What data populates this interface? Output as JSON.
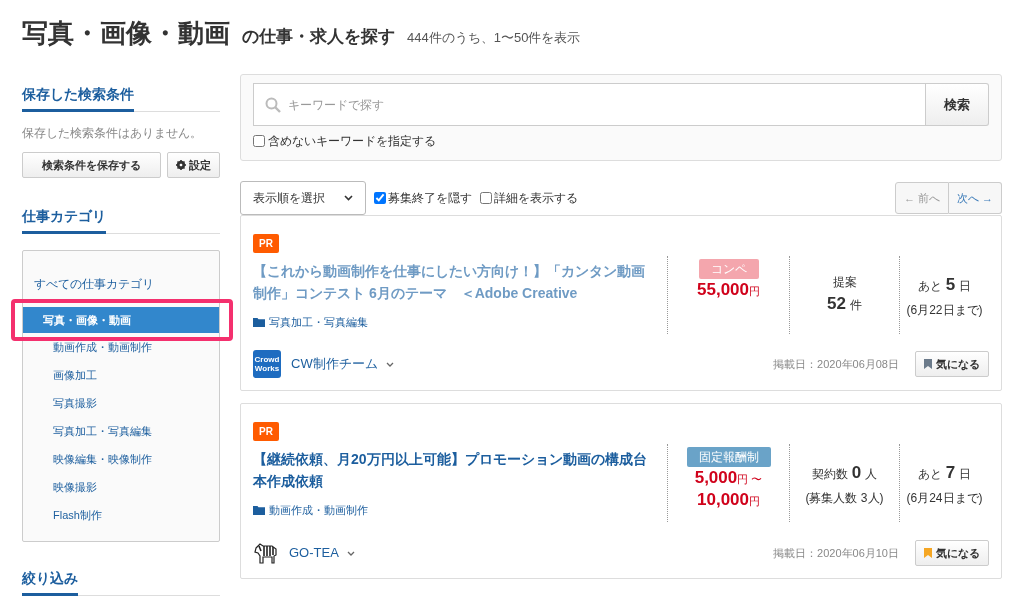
{
  "header": {
    "title": "写真・画像・動画",
    "subtitle": "の仕事・求人を探す",
    "count": "444件のうち、1〜50件を表示"
  },
  "sidebar": {
    "saved": {
      "heading": "保存した検索条件",
      "empty": "保存した検索条件はありません。",
      "save_button": "検索条件を保存する",
      "settings_button": "設定"
    },
    "categories": {
      "heading": "仕事カテゴリ",
      "all": "すべての仕事カテゴリ",
      "items": [
        {
          "label": "写真・画像・動画",
          "selected": true,
          "highlighted": true,
          "children": [
            {
              "label": "動画作成・動画制作",
              "selected": false
            },
            {
              "label": "画像加工",
              "selected": false
            },
            {
              "label": "写真撮影",
              "selected": false
            },
            {
              "label": "写真加工・写真編集",
              "selected": false
            },
            {
              "label": "映像編集・映像制作",
              "selected": false
            },
            {
              "label": "映像撮影",
              "selected": false
            },
            {
              "label": "Flash制作",
              "selected": false
            }
          ]
        }
      ]
    },
    "filter_heading": "絞り込み"
  },
  "search": {
    "placeholder": "キーワードで探す",
    "button": "検索",
    "exclude": {
      "label": "含めないキーワードを指定する",
      "checked": false
    }
  },
  "toolbar": {
    "sort": "表示順を選択",
    "options": [
      {
        "label": "募集終了を隠す",
        "checked": true
      },
      {
        "label": "詳細を表示する",
        "checked": false
      }
    ],
    "prev": {
      "label": "← 前へ",
      "disabled": true
    },
    "next": {
      "label": "次へ →",
      "disabled": false
    }
  },
  "jobs": [
    {
      "badge": "PR",
      "title": "【これから動画制作を仕事にしたい方向け！】「カンタン動画制作」コンテスト 6月のテーマ　＜Adobe Creative",
      "visited": true,
      "category": "写真加工・写真編集",
      "pay_type": {
        "label": "コンペ",
        "color": "#f4a6ad"
      },
      "price": [
        {
          "amount": "55,000",
          "unit": "円"
        }
      ],
      "stat": {
        "label": "提案",
        "value": "52",
        "unit": "件"
      },
      "deadline": {
        "prefix": "あと",
        "value": "5",
        "unit": "日",
        "note": "(6月22日まで)"
      },
      "client": {
        "name": "CW制作チーム",
        "logo": {
          "kind": "text",
          "text": "Crowd Works"
        }
      },
      "posted": "掲載日：2020年06月08日",
      "bookmark": {
        "label": "気になる",
        "on": false
      }
    },
    {
      "badge": "PR",
      "title": "【継続依頼、月20万円以上可能】プロモーション動画の構成台本作成依頼",
      "visited": false,
      "category": "動画作成・動画制作",
      "pay_type": {
        "label": "固定報酬制",
        "color": "#6aa3c8"
      },
      "price": [
        {
          "amount": "5,000",
          "unit": "円 〜"
        },
        {
          "amount": "10,000",
          "unit": "円"
        }
      ],
      "stat": {
        "label": "契約数",
        "value": "0",
        "unit": "人",
        "note": "(募集人数 3人)"
      },
      "deadline": {
        "prefix": "あと",
        "value": "7",
        "unit": "日",
        "note": "(6月24日まで)"
      },
      "client": {
        "name": "GO-TEA",
        "logo": {
          "kind": "zebra"
        }
      },
      "posted": "掲載日：2020年06月10日",
      "bookmark": {
        "label": "気になる",
        "on": true
      }
    }
  ]
}
